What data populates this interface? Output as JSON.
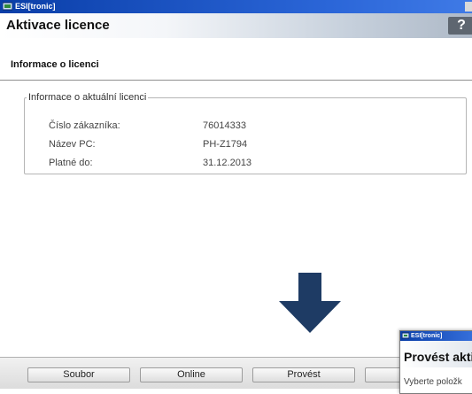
{
  "window": {
    "title": "ESI[tronic]"
  },
  "header": {
    "title": "Aktivace licence",
    "help_label": "?"
  },
  "subheader": {
    "title": "Informace o licenci"
  },
  "license_box": {
    "legend": "Informace o aktuální licenci",
    "rows": [
      {
        "label": "Číslo zákazníka:",
        "value": "76014333"
      },
      {
        "label": "Název PC:",
        "value": "PH-Z1794"
      },
      {
        "label": "Platné do:",
        "value": "31.12.2013"
      }
    ]
  },
  "buttons": {
    "soubor": "Soubor",
    "online": "Online",
    "provest": "Provést"
  },
  "popup": {
    "window_title": "ESI[tronic]",
    "title": "Provést aktiv",
    "text": "Vyberte položk"
  },
  "colors": {
    "titlebar": "#0a3ea8",
    "arrow": "#1e3b64",
    "help_button": "#5e6670"
  }
}
